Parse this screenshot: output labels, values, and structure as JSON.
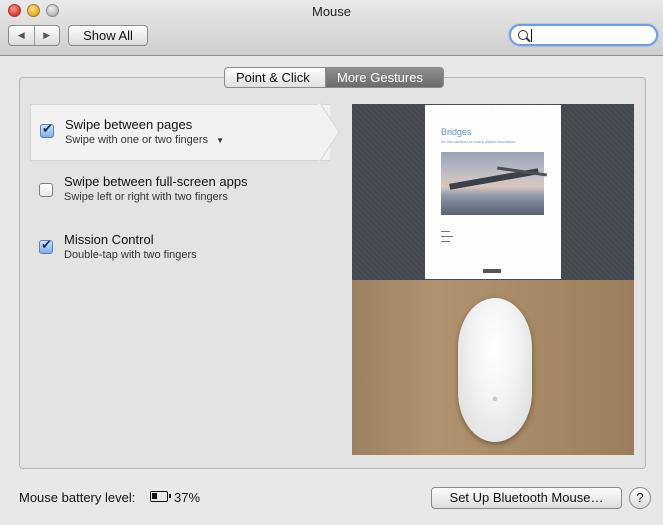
{
  "window": {
    "title": "Mouse"
  },
  "toolbar": {
    "back_icon": "◀",
    "forward_icon": "▶",
    "show_all_label": "Show All",
    "search_value": "",
    "search_placeholder": ""
  },
  "tabs": [
    {
      "label": "Point & Click",
      "selected": false
    },
    {
      "label": "More Gestures",
      "selected": true
    }
  ],
  "gestures": [
    {
      "title": "Swipe between pages",
      "subtitle": "Swipe with one or two fingers",
      "checked": true,
      "has_dropdown": true,
      "selected": true
    },
    {
      "title": "Swipe between full-screen apps",
      "subtitle": "Swipe left or right with two fingers",
      "checked": false,
      "has_dropdown": false,
      "selected": false
    },
    {
      "title": "Mission Control",
      "subtitle": "Double-tap with two fingers",
      "checked": true,
      "has_dropdown": false,
      "selected": false
    }
  ],
  "preview": {
    "doc_title": "Bridges",
    "doc_subtitle": "An introduction to man's oldest innovation"
  },
  "footer": {
    "battery_label": "Mouse battery level:",
    "battery_percent": "37%",
    "bluetooth_button": "Set Up Bluetooth Mouse…",
    "help_label": "?"
  }
}
